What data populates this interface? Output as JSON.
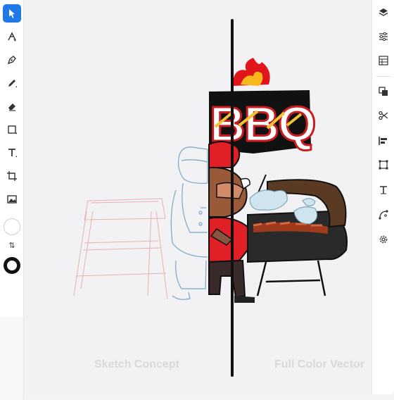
{
  "labels": {
    "left": "Sketch Concept",
    "right": "Full Color Vector"
  },
  "logo_text": "BBQ",
  "left_tools": [
    {
      "name": "select-tool",
      "icon": "pointer-icon",
      "active": true
    },
    {
      "name": "node-tool",
      "icon": "node-edit-icon"
    },
    {
      "name": "pen-tool",
      "icon": "pen-nib-icon"
    },
    {
      "name": "pencil-tool",
      "icon": "pencil-icon"
    },
    {
      "name": "eraser-tool",
      "icon": "eraser-icon"
    },
    {
      "name": "shape-tool",
      "icon": "rectangle-icon"
    },
    {
      "name": "text-tool",
      "icon": "text-icon"
    },
    {
      "name": "crop-tool",
      "icon": "crop-icon"
    },
    {
      "name": "image-tool",
      "icon": "image-icon"
    }
  ],
  "right_tools": [
    {
      "name": "layers",
      "icon": "layers-icon"
    },
    {
      "name": "adjustments",
      "icon": "sliders-icon"
    },
    {
      "name": "patterns",
      "icon": "pattern-icon"
    },
    {
      "name": "arrange",
      "icon": "arrange-icon"
    },
    {
      "name": "cut",
      "icon": "scissors-icon"
    },
    {
      "name": "align",
      "icon": "align-left-icon"
    },
    {
      "name": "transform",
      "icon": "transform-icon"
    },
    {
      "name": "text-style",
      "icon": "text-style-icon"
    },
    {
      "name": "path",
      "icon": "path-icon"
    },
    {
      "name": "settings",
      "icon": "gear-icon"
    }
  ],
  "colors": {
    "accent": "#1f7ae8",
    "stroke": "#111111",
    "fill": "#ffffff"
  }
}
